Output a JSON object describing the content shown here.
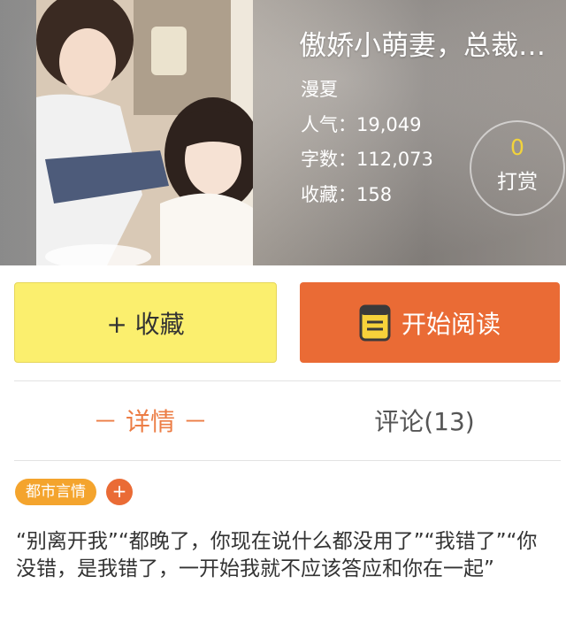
{
  "book": {
    "title": "傲娇小萌妻，总裁…",
    "author": "漫夏",
    "popularity": "人气：19,049",
    "word_count": "字数：112,073",
    "favorites": "收藏：158"
  },
  "reward": {
    "count": "0",
    "label": "打赏"
  },
  "actions": {
    "collect_label": "+ 收藏",
    "read_label": "开始阅读"
  },
  "tabs": {
    "detail_label": "－ 详情 －",
    "comment_label": "评论(13)"
  },
  "tags": {
    "items": [
      "都市言情"
    ],
    "add_label": "+"
  },
  "description": "“别离开我”“都晚了，你现在说什么都没用了”“我错了”“你没错，是我错了，一开始我就不应该答应和你在一起”",
  "colors": {
    "accent_orange": "#ea6b35",
    "collect_yellow": "#fbef6e",
    "tag_orange": "#f4a42d",
    "reward_gold": "#f2d33b"
  }
}
